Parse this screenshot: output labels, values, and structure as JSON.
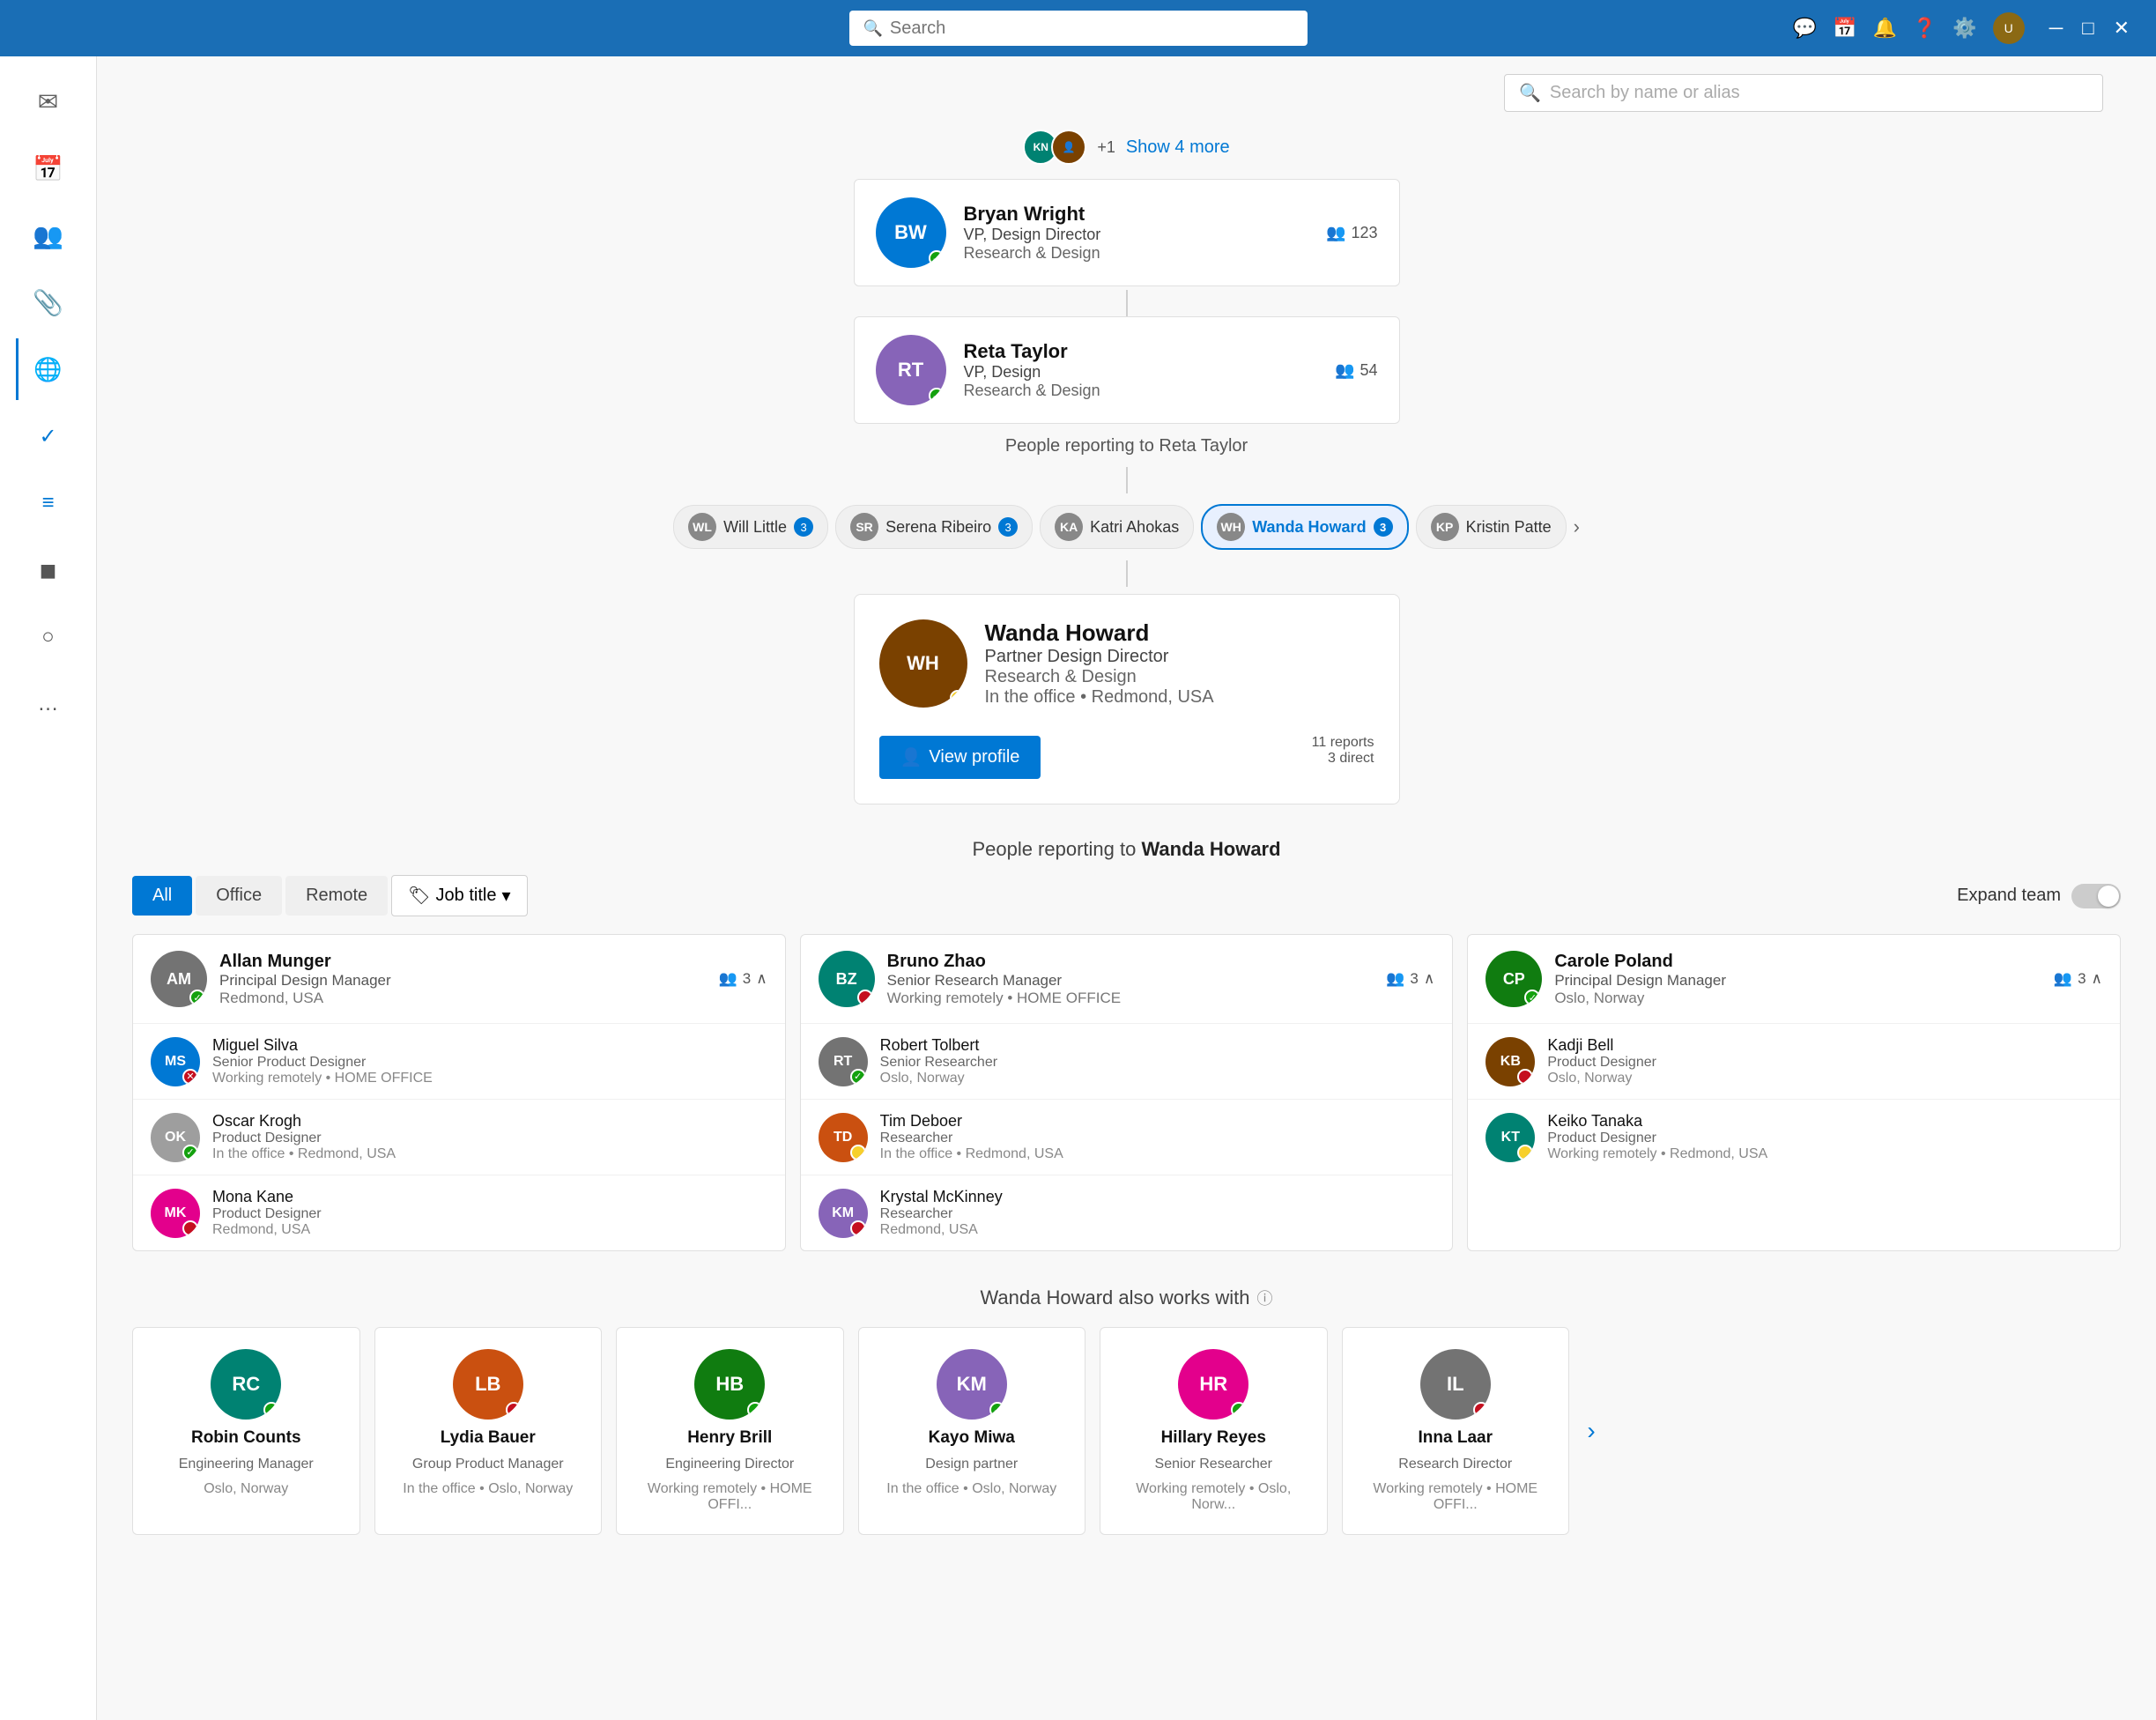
{
  "titlebar": {
    "search_placeholder": "Search",
    "icons": [
      "chat-icon",
      "calendar-icon",
      "bell-icon",
      "help-icon",
      "settings-icon"
    ]
  },
  "people_search": {
    "placeholder": "Search by name or alias"
  },
  "show_more": {
    "label": "Show 4 more",
    "plus": "+1"
  },
  "hierarchy": {
    "bryan": {
      "name": "Bryan Wright",
      "title": "VP, Design Director",
      "dept": "Research & Design",
      "count": "123",
      "initials": "BW"
    },
    "reta": {
      "name": "Reta Taylor",
      "title": "VP, Design",
      "dept": "Research & Design",
      "count": "54",
      "initials": "RT"
    }
  },
  "reports_to_reta": "People reporting to Reta Taylor",
  "chips": [
    {
      "name": "Will Little",
      "count": "3",
      "initials": "WL"
    },
    {
      "name": "Serena Ribeiro",
      "count": "3",
      "initials": "SR"
    },
    {
      "name": "Katri Ahokas",
      "initials": "KA"
    },
    {
      "name": "Wanda Howard",
      "count": "3",
      "initials": "WH",
      "active": true
    },
    {
      "name": "Kristin Patte",
      "initials": "KP"
    }
  ],
  "selected_person": {
    "name": "Wanda Howard",
    "title": "Partner Design Director",
    "dept": "Research & Design",
    "location": "In the office • Redmond, USA",
    "reports": "11 reports",
    "direct": "3 direct",
    "view_profile": "View profile",
    "initials": "WH"
  },
  "reports_to_wanda": "People reporting to Wanda Howard",
  "filter_tabs": [
    "All",
    "Office",
    "Remote"
  ],
  "active_filter": "All",
  "job_title_filter": "Job title",
  "expand_team_label": "Expand team",
  "columns": [
    {
      "manager": {
        "name": "Allan Munger",
        "title": "Principal Design Manager",
        "location": "Redmond, USA",
        "count": "3",
        "initials": "AM",
        "status": "green"
      },
      "members": [
        {
          "name": "Miguel Silva",
          "title": "Senior Product Designer",
          "location": "Working remotely • HOME OFFICE",
          "initials": "MS",
          "status": "x"
        },
        {
          "name": "Oscar Krogh",
          "title": "Product Designer",
          "location": "In the office • Redmond, USA",
          "initials": "OK",
          "status": "green"
        },
        {
          "name": "Mona Kane",
          "title": "Product Designer",
          "location": "Redmond, USA",
          "initials": "MK",
          "status": "purple-dot"
        }
      ]
    },
    {
      "manager": {
        "name": "Bruno Zhao",
        "title": "Senior Research Manager",
        "location": "Working remotely • HOME OFFICE",
        "count": "3",
        "initials": "BZ",
        "status": "red"
      },
      "members": [
        {
          "name": "Robert Tolbert",
          "title": "Senior Researcher",
          "location": "Oslo, Norway",
          "initials": "RT",
          "status": "green"
        },
        {
          "name": "Tim Deboer",
          "title": "Researcher",
          "location": "In the office • Redmond, USA",
          "initials": "TD",
          "status": "away"
        },
        {
          "name": "Krystal McKinney",
          "title": "Researcher",
          "location": "Redmond, USA",
          "initials": "KM",
          "status": "red"
        }
      ]
    },
    {
      "manager": {
        "name": "Carole Poland",
        "title": "Principal Design Manager",
        "location": "Oslo, Norway",
        "count": "3",
        "initials": "CP",
        "status": "green"
      },
      "members": [
        {
          "name": "Kadji Bell",
          "title": "Product Designer",
          "location": "Oslo, Norway",
          "initials": "KB",
          "status": "red"
        },
        {
          "name": "Keiko Tanaka",
          "title": "Product Designer",
          "location": "Working remotely • Redmond, USA",
          "initials": "KT",
          "status": "away"
        }
      ]
    }
  ],
  "also_works_with": {
    "label": "Wanda Howard also works with",
    "people": [
      {
        "name": "Robin Counts",
        "title": "Engineering Manager",
        "location": "Oslo, Norway",
        "initials": "RC"
      },
      {
        "name": "Lydia Bauer",
        "title": "Group Product Manager",
        "location": "In the office • Oslo, Norway",
        "initials": "LB"
      },
      {
        "name": "Henry Brill",
        "title": "Engineering Director",
        "location": "Working remotely • HOME OFFI...",
        "initials": "HB"
      },
      {
        "name": "Kayo Miwa",
        "title": "Design partner",
        "location": "In the office • Oslo, Norway",
        "initials": "KM"
      },
      {
        "name": "Hillary Reyes",
        "title": "Senior Researcher",
        "location": "Working remotely • Oslo, Norw...",
        "initials": "HR"
      },
      {
        "name": "Inna Laar",
        "title": "Research Director",
        "location": "Working remotely • HOME OFFI...",
        "initials": "IL"
      }
    ]
  },
  "sidebar_items": [
    {
      "icon": "✉",
      "name": "mail"
    },
    {
      "icon": "📅",
      "name": "calendar"
    },
    {
      "icon": "👥",
      "name": "people"
    },
    {
      "icon": "📎",
      "name": "attach"
    },
    {
      "icon": "🌐",
      "name": "org-chart",
      "active": true
    },
    {
      "icon": "✓",
      "name": "tasks"
    },
    {
      "icon": "≡",
      "name": "lists"
    },
    {
      "icon": "◼",
      "name": "teams"
    },
    {
      "icon": "○",
      "name": "outlook"
    },
    {
      "icon": "…",
      "name": "more"
    }
  ]
}
